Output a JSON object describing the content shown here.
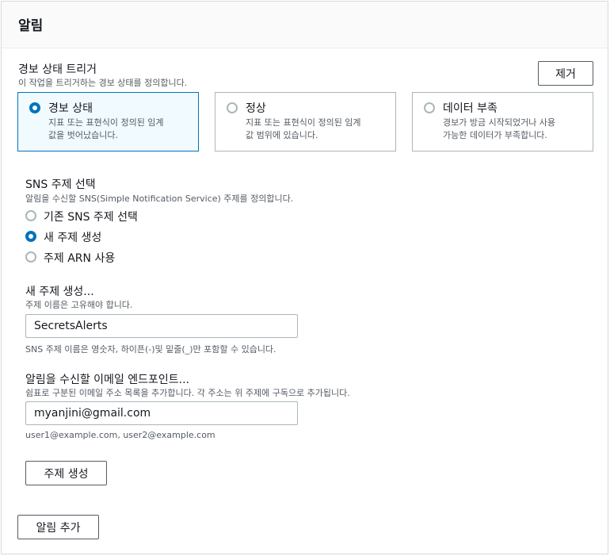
{
  "panel": {
    "title": "알림"
  },
  "trigger": {
    "title": "경보 상태 트리거",
    "description": "이 작업을 트리거하는 경보 상태를 정의합니다.",
    "remove_label": "제거",
    "options": [
      {
        "label": "경보 상태",
        "desc_line1": "지표 또는 표현식이 정의된 임계",
        "desc_line2": "값을 벗어났습니다.",
        "selected": true
      },
      {
        "label": "정상",
        "desc_line1": "지표 또는 표현식이 정의된 임계",
        "desc_line2": "값 범위에 있습니다.",
        "selected": false
      },
      {
        "label": "데이터 부족",
        "desc_line1": "경보가 방금 시작되었거나 사용",
        "desc_line2": "가능한 데이터가 부족합니다.",
        "selected": false
      }
    ]
  },
  "sns": {
    "title": "SNS 주제 선택",
    "description": "알림을 수신할 SNS(Simple Notification Service) 주제를 정의합니다.",
    "options": [
      {
        "label": "기존 SNS 주제 선택",
        "selected": false
      },
      {
        "label": "새 주제 생성",
        "selected": true
      },
      {
        "label": "주제 ARN 사용",
        "selected": false
      }
    ]
  },
  "new_topic": {
    "title": "새 주제 생성...",
    "description": "주제 이름은 고유해야 합니다.",
    "value": "SecretsAlerts",
    "hint": "SNS 주제 이름은 영숫자, 하이픈(-)및 밑줄(_)만 포함할 수 있습니다."
  },
  "email": {
    "title": "알림을 수신할 이메일 엔드포인트...",
    "description": "쉼표로 구분된 이메일 주소 목록을 추가합니다. 각 주소는 위 주제에 구독으로 추가됩니다.",
    "value": "myanjini@gmail.com",
    "hint": "user1@example.com, user2@example.com"
  },
  "create_topic_label": "주제 생성",
  "add_notification_label": "알림 추가",
  "colors": {
    "accent": "#0073bb",
    "selected_bg": "#f1faff",
    "border": "#aab7b8"
  }
}
